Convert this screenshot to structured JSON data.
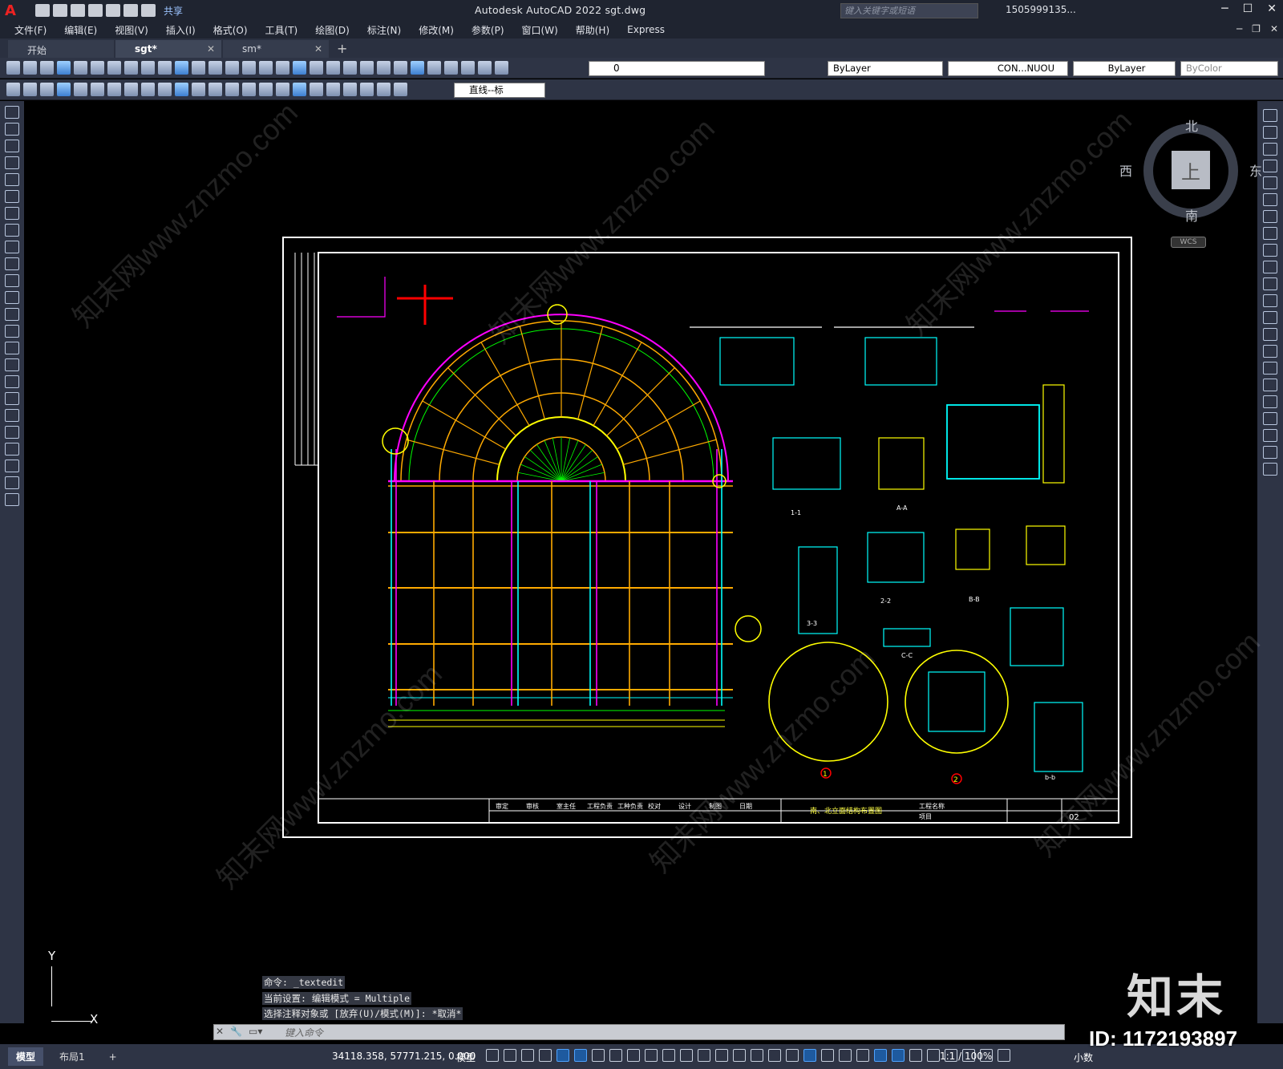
{
  "app": {
    "logo": "A",
    "title": "Autodesk AutoCAD 2022    sgt.dwg",
    "share_label": "共享",
    "search_placeholder": "键入关键字或短语",
    "user": "1505999135..."
  },
  "menu": [
    "文件(F)",
    "编辑(E)",
    "视图(V)",
    "插入(I)",
    "格式(O)",
    "工具(T)",
    "绘图(D)",
    "标注(N)",
    "修改(M)",
    "参数(P)",
    "窗口(W)",
    "帮助(H)",
    "Express"
  ],
  "tabs": [
    {
      "label": "开始"
    },
    {
      "label": "sgt*"
    },
    {
      "label": "sm*"
    }
  ],
  "toolbar": {
    "layer_value": "0",
    "color_value": "ByLayer",
    "linetype_value": "CON...NUOU",
    "lineweight_value": "ByLayer",
    "plotstyle_value": "ByColor",
    "dimstyle_value": "直线--标"
  },
  "viewcube": {
    "top": "上",
    "north": "北",
    "south": "南",
    "west": "西",
    "east": "东",
    "wcs": "WCS"
  },
  "ucs": {
    "x": "X",
    "y": "Y"
  },
  "command_history": [
    "命令: _textedit",
    "当前设置: 编辑模式 = Multiple",
    "选择注释对象或 [放弃(U)/模式(M)]: *取消*"
  ],
  "command_placeholder": "键入命令",
  "layouts": [
    "模型",
    "布局1"
  ],
  "status": {
    "coordinates": "34118.358, 57771.215, 0.000",
    "model": "模型",
    "scale": "1:1 / 100%",
    "units": "小数"
  },
  "drawing": {
    "title_block": [
      "审定",
      "审核",
      "室主任",
      "工程负责",
      "工种负责",
      "校对",
      "设计",
      "制图",
      "日期"
    ],
    "drawing_name": "南、北立面结构布置图",
    "project_label": "工程名称",
    "item_label": "项目",
    "sheet_no": "02",
    "detail_1": "1",
    "detail_2": "2",
    "section_labels": [
      "1-1",
      "A-A",
      "2-2",
      "B-B",
      "3-3",
      "C-C",
      "b-b"
    ]
  },
  "watermark": {
    "brand": "知末",
    "id": "ID: 1172193897",
    "diag_text": "知末网www.znzmo.com"
  }
}
